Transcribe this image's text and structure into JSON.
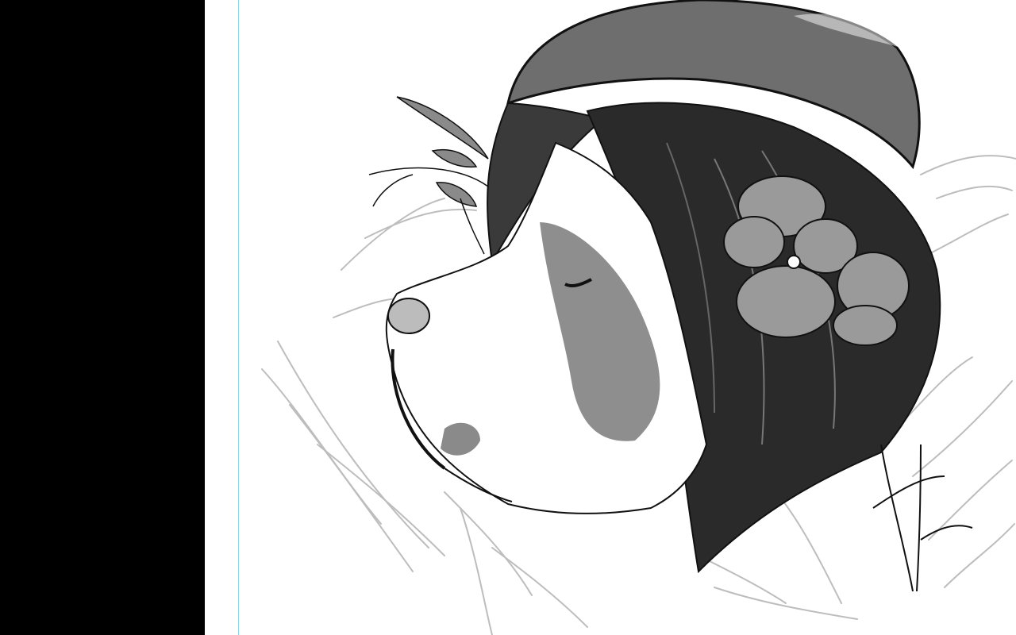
{
  "colors": {
    "side_panel": "#000000",
    "canvas_background": "#ffffff",
    "guide_line": "#8fd6e6",
    "ink": "#111111",
    "sketch_lines": "#bdbdbd",
    "shading_dark": "#2a2a2a",
    "shading_mid": "#7a7a7a"
  },
  "artwork": {
    "subject": "ink-drawing-dog-with-hat-and-pansy-flowers"
  }
}
